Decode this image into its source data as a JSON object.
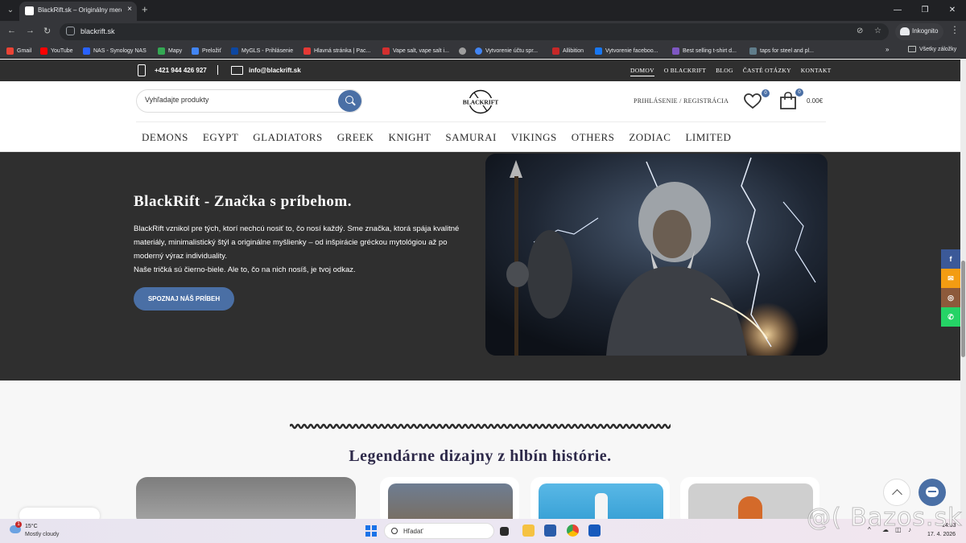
{
  "browser": {
    "tab_title": "BlackRift.sk – Originálny merch",
    "tab_close": "×",
    "new_tab": "+",
    "url": "blackrift.sk",
    "incognito_label": "Inkognito",
    "bookmarks": [
      {
        "label": "Gmail",
        "color": "#ea4335"
      },
      {
        "label": "YouTube",
        "color": "#ff0000"
      },
      {
        "label": "NAS - Synology NAS",
        "color": "#2962ff"
      },
      {
        "label": "Mapy",
        "color": "#34a853"
      },
      {
        "label": "Preložiť",
        "color": "#4285f4"
      },
      {
        "label": "MyGLS - Prihlásenie",
        "color": "#0d47a1"
      },
      {
        "label": "Hlavná stránka | Pac...",
        "color": "#e53935"
      },
      {
        "label": "Vape salt, vape salt i...",
        "color": "#d32f2f"
      },
      {
        "label": "",
        "color": "#9e9e9e"
      },
      {
        "label": "Vytvorenie účtu spr...",
        "color": "#4285f4"
      },
      {
        "label": "Allibition",
        "color": "#c62828"
      },
      {
        "label": "Vytvorenie faceboo...",
        "color": "#1877f2"
      },
      {
        "label": "Best selling t-shirt d...",
        "color": "#7e57c2"
      },
      {
        "label": "taps for steel and pl...",
        "color": "#607d8b"
      }
    ],
    "bookmarks_more": "»",
    "all_bookmarks": "Všetky záložky"
  },
  "site": {
    "phone": "+421 944 426 927",
    "email": "info@blackrift.sk",
    "top_links": [
      "DOMOV",
      "O BLACKRIFT",
      "BLOG",
      "ČASTÉ OTÁZKY",
      "KONTAKT"
    ],
    "search_placeholder": "Vyhľadajte produkty",
    "logo_text": "BLACKRIFT",
    "login": "PRIHLÁSENIE / REGISTRÁCIA",
    "wishlist_count": "0",
    "cart_count": "0",
    "cart_total": "0.00€",
    "categories": [
      "DEMONS",
      "EGYPT",
      "GLADIATORS",
      "GREEK",
      "KNIGHT",
      "SAMURAI",
      "VIKINGS",
      "OTHERS",
      "ZODIAC",
      "LIMITED"
    ],
    "hero": {
      "title": "BlackRift - Značka s príbehom.",
      "text": "BlackRift vznikol pre tých, ktorí nechcú nosiť to, čo nosí každý. Sme značka, ktorá spája kvalitné materiály, minimalistický štýl a originálne myšlienky – od inšpirácie gréckou mytológiou až po moderný výraz individuality.",
      "text2": "Naše tričká sú čierno-biele. Ale to, čo na nich nosíš, je tvoj odkaz.",
      "button": "SPOZNAJ NÁŠ PRÍBEH"
    },
    "social": [
      {
        "icon": "f",
        "color": "#3b5998"
      },
      {
        "icon": "✉",
        "color": "#f39c12"
      },
      {
        "icon": "◎",
        "color": "#8d5a3b"
      },
      {
        "icon": "✆",
        "color": "#25d366"
      }
    ],
    "section_title": "Legendárne dizajny z hlbín histórie."
  },
  "taskbar": {
    "temp": "15°C",
    "weather": "Mostly cloudy",
    "weather_badge": "1",
    "search": "Hľadať",
    "time": "14:53",
    "date": "17. 4. 2026"
  },
  "watermark": "@( Bazos.sk",
  "colors": {
    "accent": "#4a6fa5",
    "dark": "#2f2f2f",
    "title": "#2e2a4a"
  }
}
